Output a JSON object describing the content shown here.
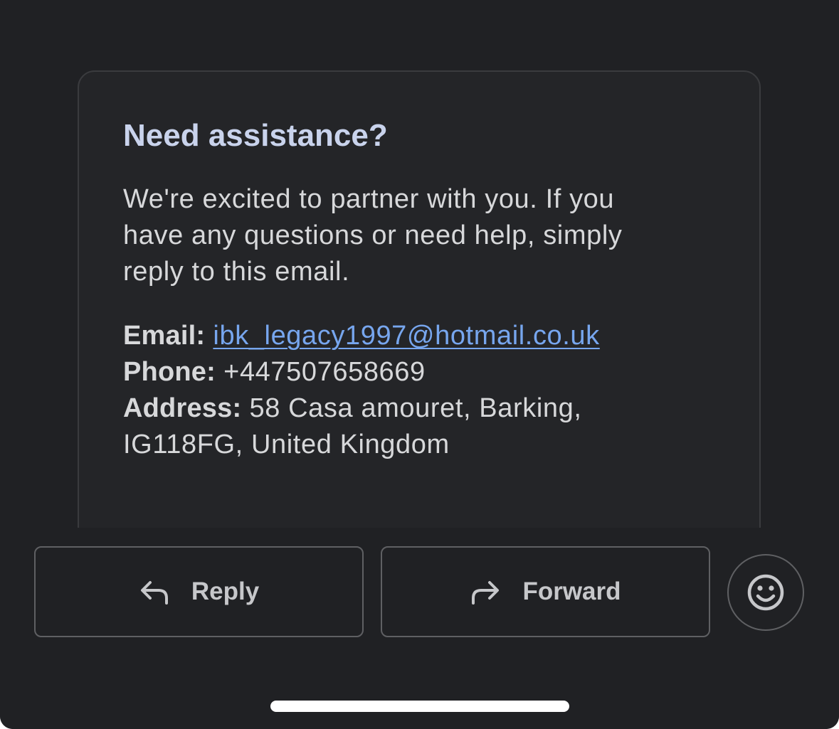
{
  "card": {
    "title": "Need assistance?",
    "body": "We're excited to partner with you. If you have any questions or need help, simply reply to this email.",
    "contact": {
      "email_label": "Email:",
      "email_value": "ibk_legacy1997@hotmail.co.uk",
      "phone_label": "Phone:",
      "phone_value": "+447507658669",
      "address_label": "Address:",
      "address_value": "58 Casa amouret, Barking, IG118FG, United Kingdom"
    }
  },
  "actions": {
    "reply_label": "Reply",
    "forward_label": "Forward",
    "reply_icon": "reply-icon",
    "forward_icon": "forward-icon",
    "emoji_icon": "smiley-icon"
  },
  "colors": {
    "background": "#202124",
    "card_background": "#242528",
    "title": "#c9d3ec",
    "link": "#77a6ee",
    "text": "#d7d8da"
  }
}
